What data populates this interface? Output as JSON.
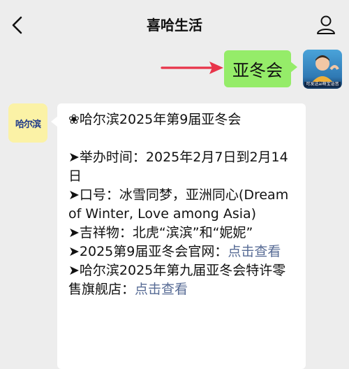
{
  "header": {
    "title": "喜哈生活"
  },
  "chat": {
    "user_message": "亚冬会",
    "user_avatar_caption": "可发送ai萌宝语音",
    "bot_avatar_text": "哈尔滨",
    "reply": {
      "line1": "❀哈尔滨2025年第9届亚冬会",
      "line2": "➤举办时间：2025年2月7日到2月14日",
      "line3": "➤口号：冰雪同梦，亚洲同心(Dream of Winter, Love among Asia)",
      "line4": "➤吉祥物：北虎“滨滨”和“妮妮”",
      "line5_prefix": "➤2025第9届亚冬会官网：",
      "line5_link": "点击查看",
      "line6_prefix": "➤哈尔滨2025年第九届亚冬会特许零售旗舰店：",
      "line6_link": "点击查看"
    }
  },
  "colors": {
    "background": "#ededed",
    "user_bubble": "#95ec69",
    "link": "#576b95",
    "arrow": "#e8344a"
  }
}
